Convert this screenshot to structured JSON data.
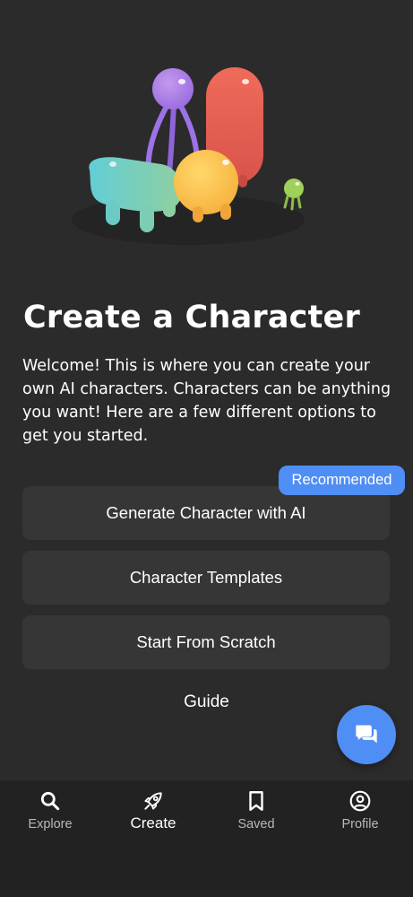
{
  "page": {
    "title": "Create a Character",
    "intro": "Welcome! This is where you can create your own AI characters. Characters can be anything you want! Here are a few different options to get you started."
  },
  "options": [
    {
      "label": "Generate Character with AI"
    },
    {
      "label": "Character Templates"
    },
    {
      "label": "Start From Scratch"
    }
  ],
  "badge": {
    "label": "Recommended"
  },
  "guide": {
    "label": "Guide"
  },
  "fab": {
    "icon": "chat-bubbles-icon"
  },
  "nav": {
    "items": [
      {
        "label": "Explore",
        "icon": "search-icon"
      },
      {
        "label": "Create",
        "icon": "rocket-icon",
        "active": true
      },
      {
        "label": "Saved",
        "icon": "bookmark-icon"
      },
      {
        "label": "Profile",
        "icon": "user-circle-icon"
      }
    ]
  },
  "colors": {
    "background": "#2b2b2b",
    "card": "#363636",
    "accent": "#4f8ef4",
    "navbar": "#222222",
    "nav_inactive": "#b8b8b8"
  }
}
